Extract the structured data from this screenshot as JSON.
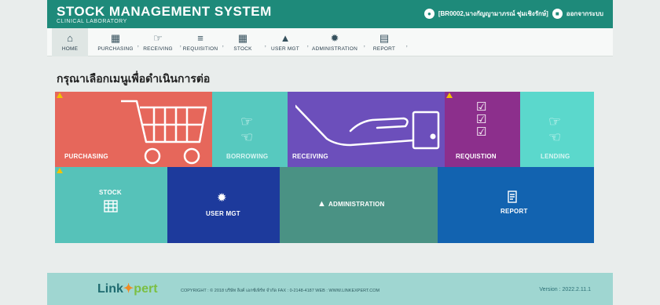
{
  "header": {
    "title": "STOCK MANAGEMENT SYSTEM",
    "subtitle": "CLINICAL LABORATORY",
    "user": "[BR0002,นางกัญญามาภรณ์ ชุ่มเชิงรักษ์]",
    "logout": "ออกจากระบบ"
  },
  "nav": [
    {
      "label": "HOME",
      "icon": "home-icon"
    },
    {
      "label": "PURCHASING",
      "icon": "cart-icon"
    },
    {
      "label": "RECEIVING",
      "icon": "hand-icon"
    },
    {
      "label": "REQUISITION",
      "icon": "checklist-icon"
    },
    {
      "label": "STOCK",
      "icon": "grid-icon"
    },
    {
      "label": "USER MGT",
      "icon": "user-icon"
    },
    {
      "label": "ADMINISTRATION",
      "icon": "gear-icon"
    },
    {
      "label": "REPORT",
      "icon": "report-icon"
    }
  ],
  "page_title": "กรุณาเลือกเมนูเพื่อดำเนินการต่อ",
  "tiles": {
    "purchasing": "PURCHASING",
    "borrowing": "BORROWING",
    "receiving": "RECEIVING",
    "requisition": "REQUISTION",
    "lending": "LENDING",
    "stock": "STOCK",
    "usermgt": "USER MGT",
    "administration": "ADMINISTRATION",
    "report": "REPORT"
  },
  "colors": {
    "purchasing": "#e6675b",
    "borrowing": "#57c9bf",
    "receiving": "#6c4fbb",
    "requisition": "#8c2f8c",
    "lending": "#5bd8cc",
    "stock": "#56c2b9",
    "usermgt": "#1d3a9c",
    "administration": "#4a9284",
    "report": "#1263b0",
    "header": "#1e8a7a",
    "footer": "#9fd6d1"
  },
  "footer": {
    "logo_part1": "Link",
    "logo_part2": "pert",
    "copyright": "COPYRIGHT : © 2018 บริษัท ลิงค์ เอกซ์เพิร์ท จำกัด  FAX : 0-2148-4187  WEB : WWW.LINKEXPERT.COM",
    "version": "Version : 2022.2.11.1"
  }
}
